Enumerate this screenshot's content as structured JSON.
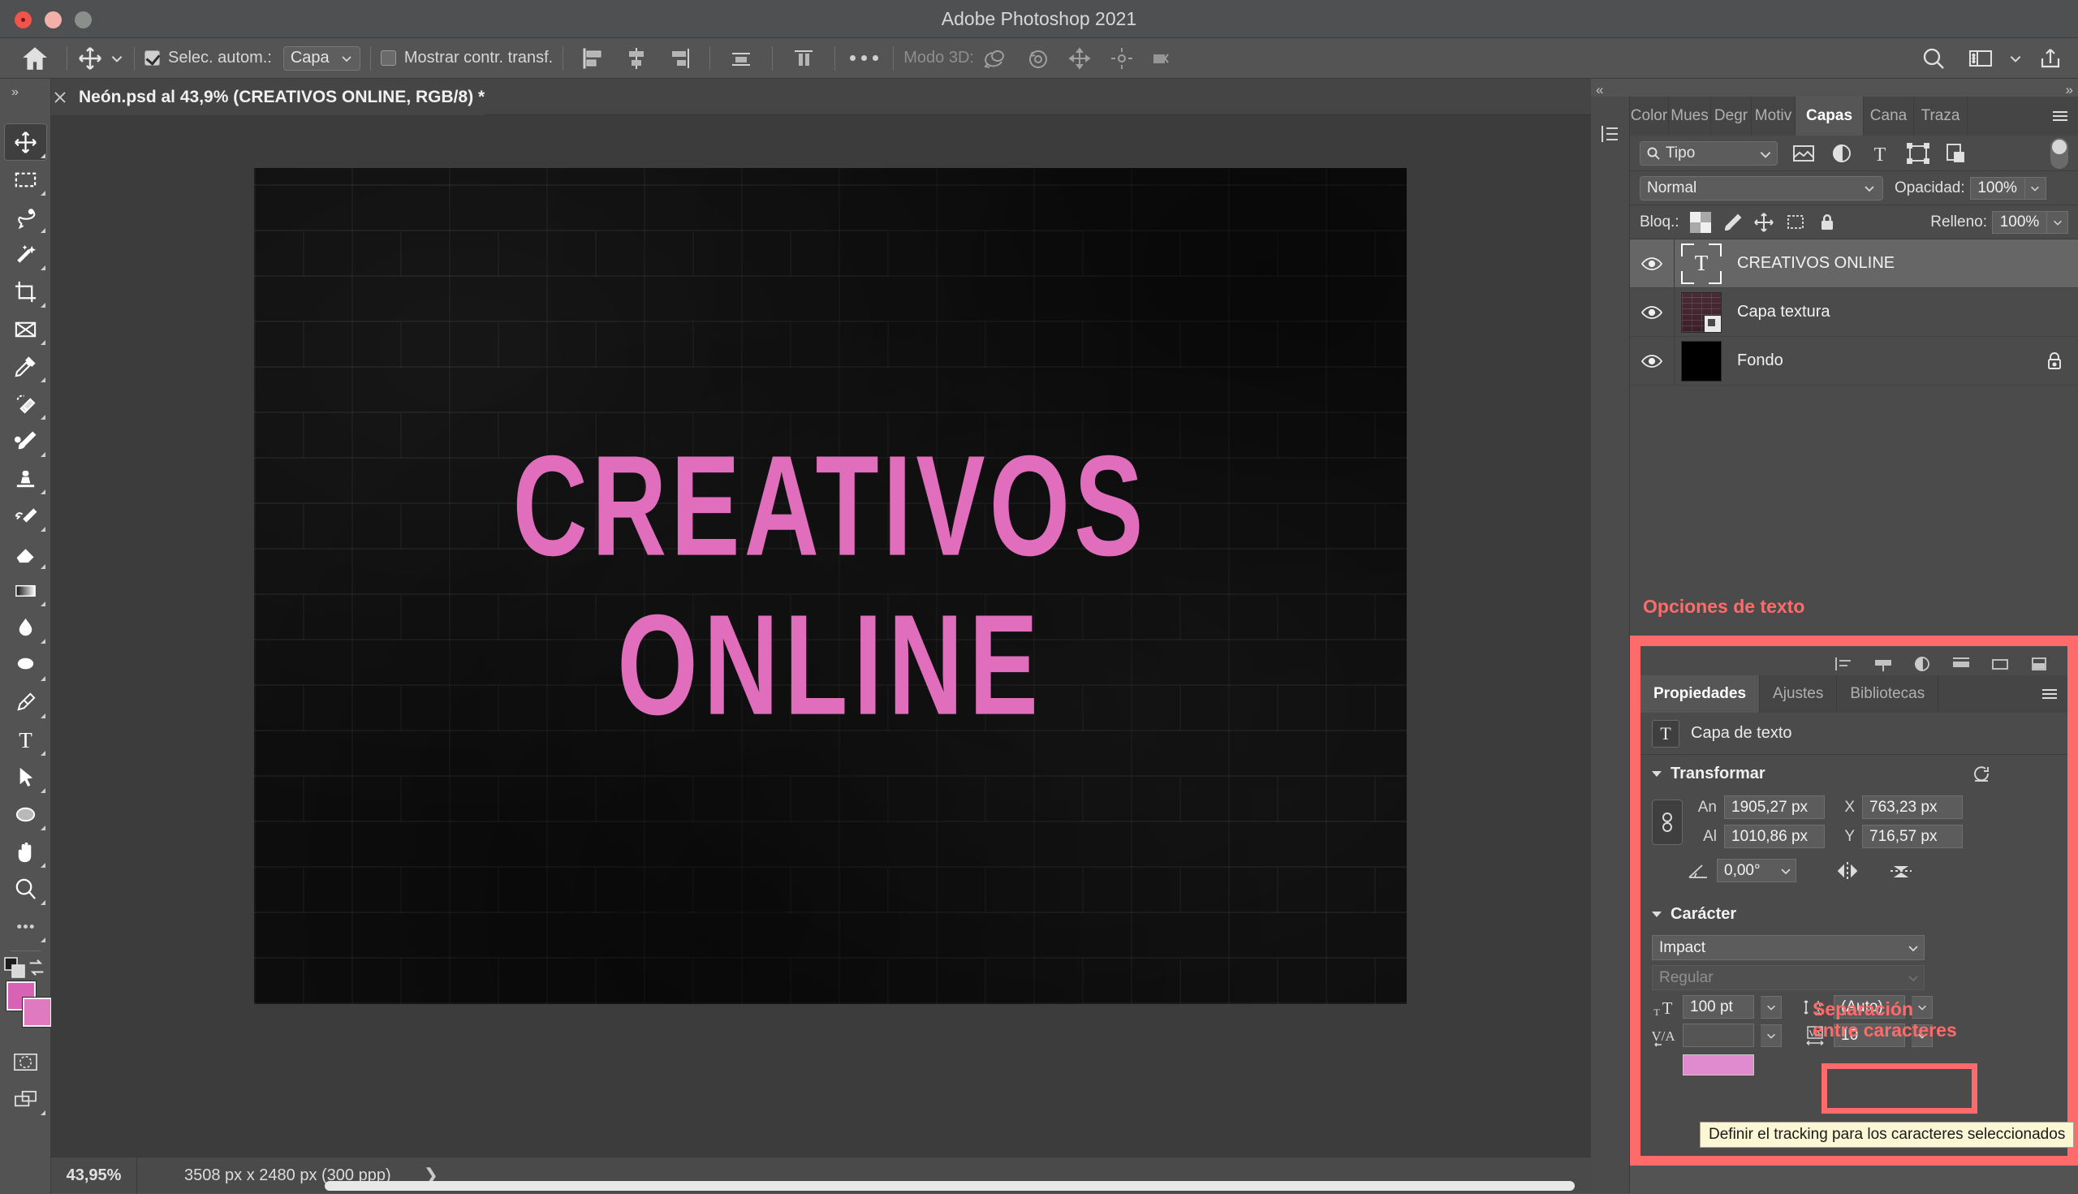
{
  "window": {
    "app_title": "Adobe Photoshop 2021",
    "traffic_lights": [
      "close-button",
      "minimize-button",
      "maximize-button"
    ]
  },
  "options_bar": {
    "home_icon": "home-icon",
    "tool_icon": "move-tool-icon",
    "auto_select": {
      "label": "Selec. autom.:",
      "checked": true,
      "value": "Capa"
    },
    "show_transform": {
      "label": "Mostrar contr. transf.",
      "checked": false
    },
    "align_icons": [
      "align-left-edges-icon",
      "align-horizontal-centers-icon",
      "align-right-edges-icon",
      "align-top-edges-icon",
      "distribute-vertical-icon"
    ],
    "more_label": "•••",
    "mode_3d": {
      "label": "Modo 3D:",
      "icons": [
        "rotate-3d-icon",
        "roll-3d-icon",
        "pan-3d-icon",
        "slide-3d-icon",
        "scale-3d-camera-icon"
      ]
    },
    "right_icons": [
      "search-icon",
      "workspace-icon",
      "chevron-down-icon",
      "share-icon"
    ]
  },
  "document_tab": {
    "close_icon": "close-icon",
    "title": "Neón.psd al 43,9% (CREATIVOS  ONLINE, RGB/8) *"
  },
  "toolbar": {
    "tools": [
      {
        "name": "move-tool",
        "active": true
      },
      {
        "name": "rectangular-marquee-tool",
        "active": false
      },
      {
        "name": "lasso-tool",
        "active": false
      },
      {
        "name": "magic-wand-tool",
        "active": false
      },
      {
        "name": "crop-tool",
        "active": false
      },
      {
        "name": "frame-tool",
        "active": false
      },
      {
        "name": "eyedropper-tool",
        "active": false
      },
      {
        "name": "spot-healing-brush-tool",
        "active": false
      },
      {
        "name": "brush-tool",
        "active": false
      },
      {
        "name": "clone-stamp-tool",
        "active": false
      },
      {
        "name": "history-brush-tool",
        "active": false
      },
      {
        "name": "eraser-tool",
        "active": false
      },
      {
        "name": "gradient-tool",
        "active": false
      },
      {
        "name": "blur-tool",
        "active": false
      },
      {
        "name": "dodge-tool",
        "active": false
      },
      {
        "name": "pen-tool",
        "active": false
      },
      {
        "name": "type-tool",
        "active": false
      },
      {
        "name": "path-selection-tool",
        "active": false
      },
      {
        "name": "ellipse-tool",
        "active": false
      },
      {
        "name": "hand-tool",
        "active": false
      },
      {
        "name": "zoom-tool",
        "active": false
      },
      {
        "name": "more-tools",
        "active": false
      }
    ],
    "foreground_color": "#d862b4",
    "background_color": "#e07ac0",
    "quick_mask_icon": "quick-mask-icon",
    "screen_mode_icon": "screen-mode-icon",
    "swap_colors_icon": "swap-colors-icon",
    "default_colors_icon": "default-colors-icon"
  },
  "canvas": {
    "neon_line1": "CREATIVOS",
    "neon_line2": "ONLINE",
    "neon_color": "#e06ebc",
    "background_color": "#0e0e0e"
  },
  "status_bar": {
    "zoom": "43,95%",
    "doc_size": "3508 px x 2480 px (300 ppp)",
    "expand_arrow": "❯"
  },
  "layers_panel": {
    "tabs": [
      {
        "label": "Color",
        "active": false
      },
      {
        "label": "Mues",
        "active": false
      },
      {
        "label": "Degr",
        "active": false
      },
      {
        "label": "Motiv",
        "active": false
      },
      {
        "label": "Capas",
        "active": true
      },
      {
        "label": "Cana",
        "active": false
      },
      {
        "label": "Traza",
        "active": false
      }
    ],
    "menu_icon": "panel-menu-icon",
    "filter": {
      "search_icon": "search-icon",
      "value": "Tipo",
      "type_icons": [
        "filter-pixel-icon",
        "filter-adjustment-icon",
        "filter-type-icon",
        "filter-shape-icon",
        "filter-smart-object-icon"
      ],
      "toggle": "filter-enable-toggle"
    },
    "blend": {
      "mode": "Normal",
      "opacity_label": "Opacidad:",
      "opacity": "100%"
    },
    "lock": {
      "label": "Bloq.:",
      "icons": [
        "lock-transparency-icon",
        "lock-image-icon",
        "lock-position-icon",
        "lock-artboard-icon",
        "lock-all-icon"
      ],
      "fill_label": "Relleno:",
      "fill": "100%"
    },
    "layers": [
      {
        "name": "CREATIVOS  ONLINE",
        "type": "text",
        "visible": true,
        "selected": true,
        "locked": false
      },
      {
        "name": "Capa textura",
        "type": "smart-object",
        "visible": true,
        "selected": false,
        "locked": false
      },
      {
        "name": "Fondo",
        "type": "solid",
        "visible": true,
        "selected": false,
        "locked": true
      }
    ]
  },
  "annotations": {
    "text_options_label": "Opciones de texto",
    "tracking_label_line1": "Separación",
    "tracking_label_line2": "entre caracteres",
    "highlight_color": "#ff6b6b"
  },
  "properties_panel": {
    "top_icons": [
      "align-left-icon",
      "align-center-icon",
      "align-right-icon",
      "align-top-icon",
      "align-middle-icon",
      "align-bottom-icon"
    ],
    "tabs": [
      {
        "label": "Propiedades",
        "active": true
      },
      {
        "label": "Ajustes",
        "active": false
      },
      {
        "label": "Bibliotecas",
        "active": false
      }
    ],
    "menu_icon": "panel-menu-icon",
    "header": {
      "icon": "T",
      "label": "Capa de texto"
    },
    "transform": {
      "title": "Transformar",
      "reset_icon": "reset-icon",
      "link_icon": "link-aspect-ratio-icon",
      "width_label": "An",
      "width": "1905,27 px",
      "height_label": "Al",
      "height": "1010,86 px",
      "x_label": "X",
      "x": "763,23 px",
      "y_label": "Y",
      "y": "716,57 px",
      "angle_icon": "angle-icon",
      "angle": "0,00°",
      "flip_h_icon": "flip-horizontal-icon",
      "flip_v_icon": "flip-vertical-icon"
    },
    "character": {
      "title": "Carácter",
      "font_family": "Impact",
      "font_style": "Regular",
      "size_icon": "font-size-icon",
      "size": "100 pt",
      "leading_icon": "leading-icon",
      "leading": "(Auto)",
      "vertical_scale_icon": "vertical-scale-icon",
      "vertical_scale": "",
      "tracking_icon": "tracking-icon",
      "tracking": "10",
      "color_swatch": "#e08ad0"
    }
  },
  "tooltip": {
    "text": "Definir el tracking para los caracteres seleccionados"
  }
}
